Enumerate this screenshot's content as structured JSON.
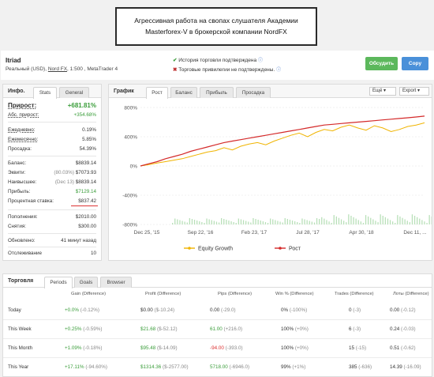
{
  "banner": {
    "line1": "Агрессивная работа на свопах слушателя Академии",
    "line2": "Masterforex-V в брокерской компании NordFX"
  },
  "account": {
    "name": "Itriad",
    "type": "Реальный (USD),",
    "broker": "Nord FX",
    "details": ", 1:500 , MetaTrader 4"
  },
  "verification": {
    "history": "История торговли подтверждена",
    "privileges": "Торговые привилегии не подтверждены."
  },
  "buttons": {
    "discuss": "Обсудить",
    "copy": "Copy"
  },
  "info_panel": {
    "title": "Инфо.",
    "tabs": [
      "Stats",
      "General"
    ],
    "rows": [
      {
        "label": "Прирост:",
        "value": "+681.81%"
      },
      {
        "label": "Абс. прирост:",
        "value": "+354.68%"
      },
      {
        "label": "Ежедневно:",
        "value": "0.19%"
      },
      {
        "label": "Ежемесячно:",
        "value": "5.85%"
      },
      {
        "label": "Просадка:",
        "value": "54.39%"
      },
      {
        "label": "Баланс:",
        "value": "$8839.14"
      },
      {
        "label": "Эквити:",
        "note": "(80.03%)",
        "value": "$7073.93"
      },
      {
        "label": "Наивысшее:",
        "note": "(Dec 13)",
        "value": "$8839.14"
      },
      {
        "label": "Прибыль:",
        "value": "$7129.14"
      },
      {
        "label": "Процентная ставка:",
        "value": "$837.42"
      },
      {
        "label": "Пополнения:",
        "value": "$2010.00"
      },
      {
        "label": "Снятия:",
        "value": "$300.00"
      },
      {
        "label": "Обновлено:",
        "value": "41 минут назад"
      },
      {
        "label": "Отслеживание",
        "value": "10"
      }
    ]
  },
  "chart_panel": {
    "title": "График",
    "tabs": [
      "Рост",
      "Баланс",
      "Прибыль",
      "Просадка"
    ],
    "dropdowns": [
      "Ещё",
      "Export"
    ]
  },
  "chart_data": {
    "type": "line",
    "x_ticks": [
      "Dec 25, '15",
      "Sep 22, '16",
      "Feb 23, '17",
      "Jul 28, '17",
      "Apr 30, '18",
      "Dec 11, ..."
    ],
    "y_ticks": [
      "800%",
      "400%",
      "0%",
      "-400%",
      "-800%"
    ],
    "ylim": [
      -800,
      800
    ],
    "series": [
      {
        "name": "Equity Growth",
        "color": "#f0b400",
        "values": [
          0,
          20,
          40,
          60,
          80,
          100,
          130,
          160,
          190,
          210,
          250,
          220,
          270,
          300,
          320,
          290,
          340,
          380,
          420,
          450,
          400,
          460,
          500,
          480,
          530,
          560,
          520,
          490,
          550,
          520,
          470,
          500,
          540,
          560,
          590
        ]
      },
      {
        "name": "Рост",
        "color": "#d42a2a",
        "values": [
          0,
          30,
          60,
          100,
          130,
          160,
          200,
          230,
          260,
          290,
          320,
          340,
          360,
          380,
          400,
          420,
          440,
          460,
          480,
          500,
          520,
          540,
          560,
          570,
          580,
          590,
          600,
          610,
          620,
          630,
          640,
          650,
          660,
          670,
          682
        ]
      }
    ],
    "grid": true,
    "legend": "bottom"
  },
  "trading": {
    "title": "Торговля",
    "tabs": [
      "Periods",
      "Goals",
      "Browser"
    ],
    "headers": [
      "Gain (Difference)",
      "Profit (Difference)",
      "Pips (Difference)",
      "Win % (Difference)",
      "Trades (Difference)",
      "Лоты (Difference)"
    ],
    "rows": [
      {
        "period": "Today",
        "gain": "+0.0%",
        "gain_d": "(-0.12%)",
        "profit": "$0.00",
        "profit_d": "($-10.24)",
        "pips": "0.00",
        "pips_d": "(-29.0)",
        "win": "0%",
        "win_d": "(-100%)",
        "trades": "0",
        "trades_d": "(-3)",
        "lots": "0.00",
        "lots_d": "(-0.12)"
      },
      {
        "period": "This Week",
        "gain": "+0.25%",
        "gain_d": "(-0.59%)",
        "profit": "$21.68",
        "profit_d": "($-52.12)",
        "pips": "61.00",
        "pips_d": "(+216.0)",
        "win": "100%",
        "win_d": "(+0%)",
        "trades": "6",
        "trades_d": "(-3)",
        "lots": "0.24",
        "lots_d": "(-0.03)"
      },
      {
        "period": "This Month",
        "gain": "+1.09%",
        "gain_d": "(-0.18%)",
        "profit": "$95.48",
        "profit_d": "($-14.09)",
        "pips": "-94.00",
        "pips_d": "(-393.0)",
        "win": "100%",
        "win_d": "(+0%)",
        "trades": "15",
        "trades_d": "(-15)",
        "lots": "0.51",
        "lots_d": "(-0.62)"
      },
      {
        "period": "This Year",
        "gain": "+17.11%",
        "gain_d": "(-94.60%)",
        "profit": "$1314.36",
        "profit_d": "($-2577.00)",
        "pips": "5718.00",
        "pips_d": "(-6946.0)",
        "win": "99%",
        "win_d": "(+1%)",
        "trades": "385",
        "trades_d": "(-636)",
        "lots": "14.39",
        "lots_d": "(-16.09)"
      }
    ]
  }
}
